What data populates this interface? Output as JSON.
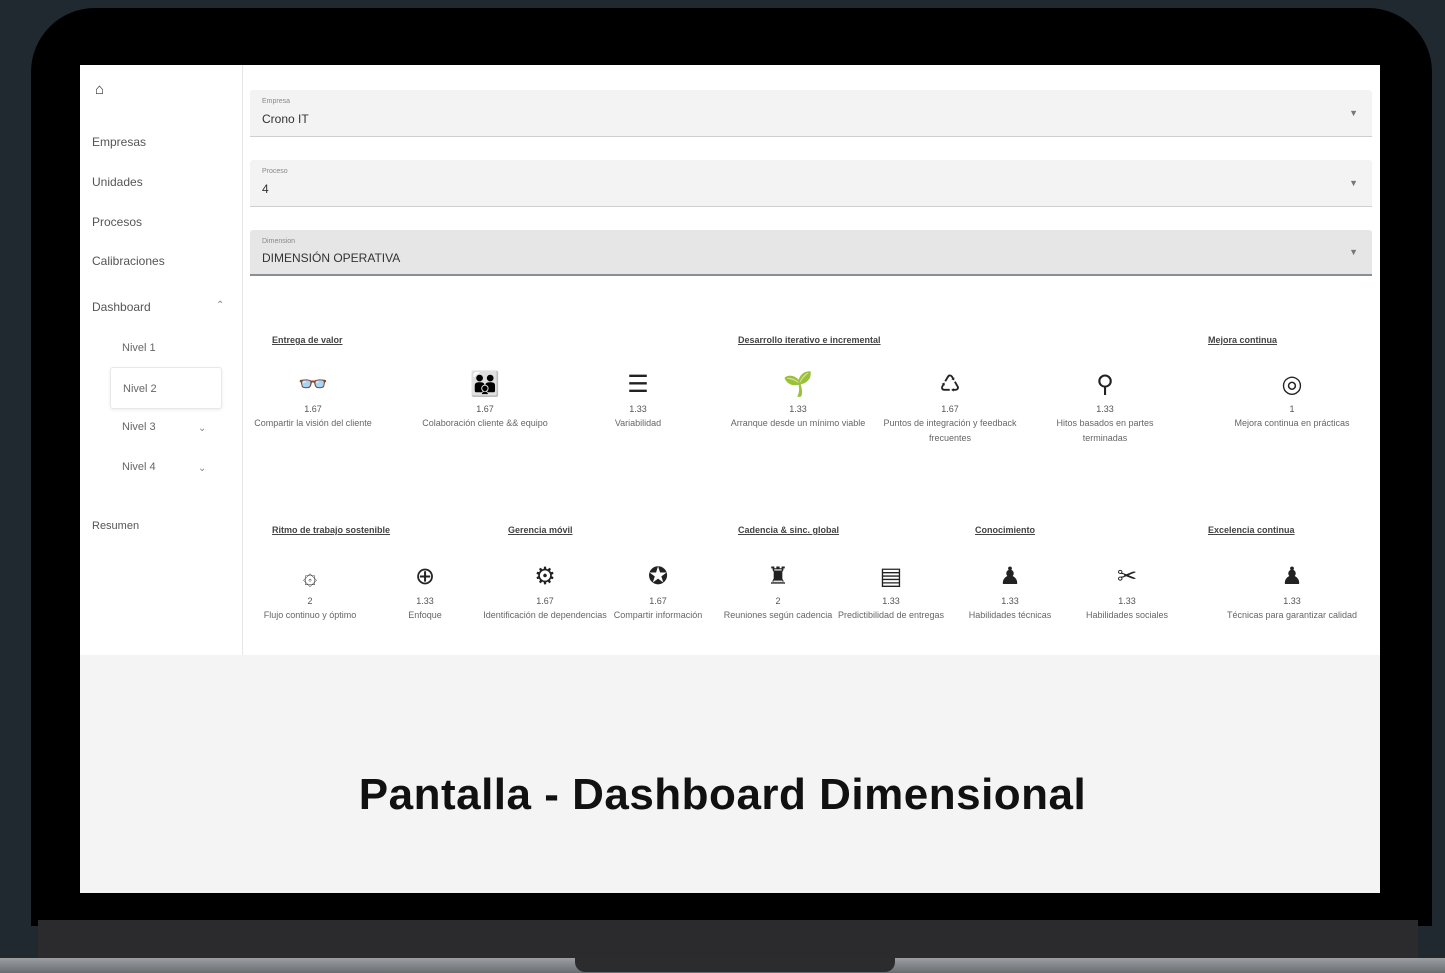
{
  "sidebar": {
    "home_icon": "home-icon",
    "items": [
      {
        "label": "Empresas"
      },
      {
        "label": "Unidades"
      },
      {
        "label": "Procesos"
      },
      {
        "label": "Calibraciones"
      },
      {
        "label": "Dashboard"
      }
    ],
    "sub_items": [
      {
        "label": "Nivel 1"
      },
      {
        "label": "Nivel 2"
      },
      {
        "label": "Nivel 3"
      },
      {
        "label": "Nivel 4"
      }
    ],
    "resumen": "Resumen"
  },
  "filters": [
    {
      "label": "Empresa",
      "value": "Crono IT"
    },
    {
      "label": "Proceso",
      "value": "4"
    },
    {
      "label": "Dimension",
      "value": "DIMENSIÓN OPERATIVA"
    }
  ],
  "categories_row1": [
    {
      "title": "Entrega de valor"
    },
    {
      "title": "Desarrollo iterativo e incremental"
    },
    {
      "title": "Mejora continua"
    }
  ],
  "categories_row2": [
    {
      "title": "Ritmo de trabajo sostenible"
    },
    {
      "title": "Gerencia móvil"
    },
    {
      "title": "Cadencia & sinc. global"
    },
    {
      "title": "Conocimiento"
    },
    {
      "title": "Excelencia continua"
    }
  ],
  "metrics_row1": [
    {
      "icon": "glasses-icon",
      "glyph": "👓",
      "value": "1.67",
      "label": "Compartir la visión del cliente"
    },
    {
      "icon": "people-icon",
      "glyph": "👪",
      "value": "1.67",
      "label": "Colaboración cliente && equipo"
    },
    {
      "icon": "list-icon",
      "glyph": "☰",
      "value": "1.33",
      "label": "Variabilidad"
    },
    {
      "icon": "seedling-icon",
      "glyph": "🌱",
      "value": "1.33",
      "label": "Arranque desde un mínimo viable"
    },
    {
      "icon": "feedback-icon",
      "glyph": "♺",
      "value": "1.67",
      "label": "Puntos de integración y feedback frecuentes"
    },
    {
      "icon": "milestones-icon",
      "glyph": "⚲",
      "value": "1.33",
      "label": "Hitos basados en partes terminadas"
    },
    {
      "icon": "target-icon",
      "glyph": "◎",
      "value": "1",
      "label": "Mejora continua en prácticas"
    }
  ],
  "metrics_row2": [
    {
      "icon": "flow-icon",
      "glyph": "۞",
      "value": "2",
      "label": "Flujo continuo y óptimo"
    },
    {
      "icon": "crosshair-icon",
      "glyph": "⊕",
      "value": "1.33",
      "label": "Enfoque"
    },
    {
      "icon": "dependencies-icon",
      "glyph": "⚙",
      "value": "1.67",
      "label": "Identificación de dependencias"
    },
    {
      "icon": "share-icon",
      "glyph": "✪",
      "value": "1.67",
      "label": "Compartir información"
    },
    {
      "icon": "meetings-icon",
      "glyph": "♜",
      "value": "2",
      "label": "Reuniones según cadencia"
    },
    {
      "icon": "predictability-icon",
      "glyph": "▤",
      "value": "1.33",
      "label": "Predictibilidad de entregas"
    },
    {
      "icon": "technical-skills-icon",
      "glyph": "♟",
      "value": "1.33",
      "label": "Habilidades técnicas"
    },
    {
      "icon": "social-skills-icon",
      "glyph": "✂",
      "value": "1.33",
      "label": "Habilidades sociales"
    },
    {
      "icon": "quality-icon",
      "glyph": "♟",
      "value": "1.33",
      "label": "Técnicas para garantizar calidad"
    }
  ],
  "caption": "Pantalla - Dashboard Dimensional"
}
